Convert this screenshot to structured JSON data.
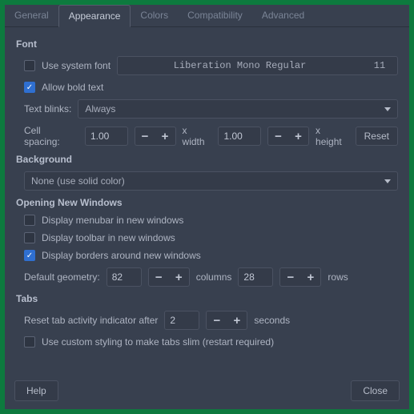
{
  "tabs": [
    "General",
    "Appearance",
    "Colors",
    "Compatibility",
    "Advanced"
  ],
  "active_tab": "Appearance",
  "font": {
    "section": "Font",
    "use_system_label": "Use system font",
    "font_name": "Liberation Mono Regular",
    "font_size": "11",
    "allow_bold_label": "Allow bold text",
    "text_blinks_label": "Text blinks:",
    "text_blinks_value": "Always",
    "cell_spacing_label": "Cell spacing:",
    "width_value": "1.00",
    "width_suffix": "x width",
    "height_value": "1.00",
    "height_suffix": "x height",
    "reset_label": "Reset"
  },
  "background": {
    "section": "Background",
    "value": "None (use solid color)"
  },
  "new_windows": {
    "section": "Opening New Windows",
    "menubar_label": "Display menubar in new windows",
    "toolbar_label": "Display toolbar in new windows",
    "borders_label": "Display borders around new windows",
    "default_geometry_label": "Default geometry:",
    "cols_value": "82",
    "cols_suffix": "columns",
    "rows_value": "28",
    "rows_suffix": "rows"
  },
  "tabs_section": {
    "section": "Tabs",
    "reset_label_pre": "Reset tab activity indicator after",
    "reset_value": "2",
    "reset_label_post": "seconds",
    "custom_styling_label": "Use custom styling to make tabs slim (restart required)"
  },
  "footer": {
    "help": "Help",
    "close": "Close"
  }
}
